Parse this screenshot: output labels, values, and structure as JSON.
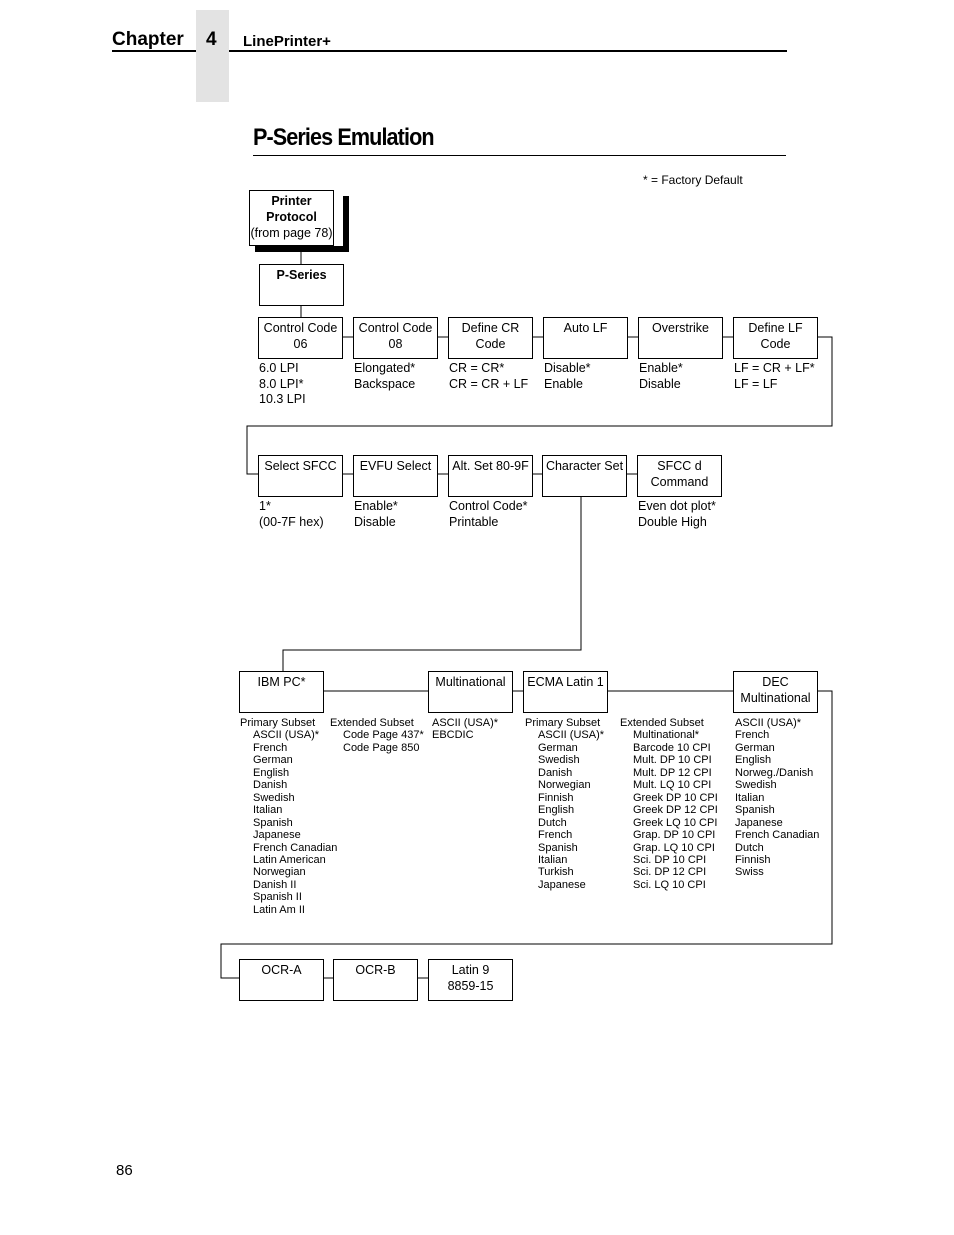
{
  "header": {
    "chapter_label": "Chapter",
    "chapter_number": "4",
    "running_title": "LinePrinter+"
  },
  "title": "P-Series Emulation",
  "legend": "* = Factory Default",
  "root": {
    "lines": [
      "Printer",
      "Protocol",
      "(from page 78)"
    ]
  },
  "pseries": {
    "label": "P-Series"
  },
  "row1": [
    {
      "label": [
        "Control Code",
        "06"
      ],
      "options": [
        "6.0 LPI",
        "8.0 LPI*",
        "10.3 LPI"
      ]
    },
    {
      "label": [
        "Control Code",
        "08"
      ],
      "options": [
        "Elongated*",
        "Backspace"
      ]
    },
    {
      "label": [
        "Define CR",
        "Code"
      ],
      "options": [
        "CR = CR*",
        "CR = CR + LF"
      ]
    },
    {
      "label": [
        "Auto LF"
      ],
      "options": [
        "Disable*",
        "Enable"
      ]
    },
    {
      "label": [
        "Overstrike"
      ],
      "options": [
        "Enable*",
        "Disable"
      ]
    },
    {
      "label": [
        "Define LF",
        "Code"
      ],
      "options": [
        "LF = CR + LF*",
        "LF = LF"
      ]
    }
  ],
  "row2": [
    {
      "label": [
        "Select SFCC"
      ],
      "options": [
        "1*",
        "(00-7F hex)"
      ]
    },
    {
      "label": [
        "EVFU Select"
      ],
      "options": [
        "Enable*",
        "Disable"
      ]
    },
    {
      "label": [
        "Alt. Set 80-9F"
      ],
      "options": [
        "Control Code*",
        "Printable"
      ]
    },
    {
      "label": [
        "Character Set"
      ],
      "options": []
    },
    {
      "label": [
        "SFCC d",
        "Command"
      ],
      "options": [
        "Even dot plot*",
        "Double High"
      ]
    }
  ],
  "row3": [
    {
      "label": [
        "IBM PC*"
      ]
    },
    {
      "label": [
        "Multinational"
      ]
    },
    {
      "label": [
        "ECMA Latin 1"
      ]
    },
    {
      "label": [
        "DEC",
        "Multinational"
      ]
    }
  ],
  "ibm_primary": {
    "heading": "Primary Subset",
    "items": [
      "ASCII (USA)*",
      "French",
      "German",
      "English",
      "Danish",
      "Swedish",
      "Italian",
      "Spanish",
      "Japanese",
      "French Canadian",
      "Latin American",
      "Norwegian",
      "Danish II",
      "Spanish II",
      "Latin Am II"
    ]
  },
  "ibm_extended": {
    "heading": "Extended Subset",
    "items": [
      "Code Page 437*",
      "Code Page 850"
    ]
  },
  "multinational_options": [
    "ASCII (USA)*",
    "EBCDIC"
  ],
  "ecma_primary": {
    "heading": "Primary Subset",
    "items": [
      "ASCII (USA)*",
      "German",
      "Swedish",
      "Danish",
      "Norwegian",
      "Finnish",
      "English",
      "Dutch",
      "French",
      "Spanish",
      "Italian",
      "Turkish",
      "Japanese"
    ]
  },
  "ecma_extended": {
    "heading": "Extended Subset",
    "items": [
      "Multinational*",
      "Barcode 10 CPI",
      "Mult. DP 10 CPI",
      "Mult. DP 12 CPI",
      "Mult. LQ 10 CPI",
      "Greek DP 10 CPI",
      "Greek DP 12 CPI",
      "Greek LQ 10 CPI",
      "Grap. DP 10 CPI",
      "Grap. LQ 10 CPI",
      "Sci. DP 10 CPI",
      "Sci. DP 12 CPI",
      "Sci. LQ 10 CPI"
    ]
  },
  "dec_options": [
    "ASCII (USA)*",
    "French",
    "German",
    "English",
    "Norweg./Danish",
    "Swedish",
    "Italian",
    "Spanish",
    "Japanese",
    "French Canadian",
    "Dutch",
    "Finnish",
    "Swiss"
  ],
  "row4": [
    {
      "label": [
        "OCR-A"
      ]
    },
    {
      "label": [
        "OCR-B"
      ]
    },
    {
      "label": [
        "Latin 9",
        "8859-15"
      ]
    }
  ],
  "page_number": "86"
}
